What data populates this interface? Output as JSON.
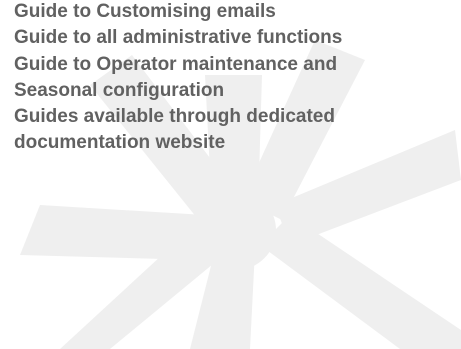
{
  "colors": {
    "text": "#616161",
    "watermark": "#eeeeee",
    "background": "#ffffff"
  },
  "watermark": {
    "icon": "starburst-logo-watermark"
  },
  "lines": [
    "Guide to Customising emails",
    "Guide to all administrative functions",
    "Guide to Operator maintenance and",
    "Seasonal configuration",
    "Guides available through dedicated",
    "documentation website"
  ]
}
